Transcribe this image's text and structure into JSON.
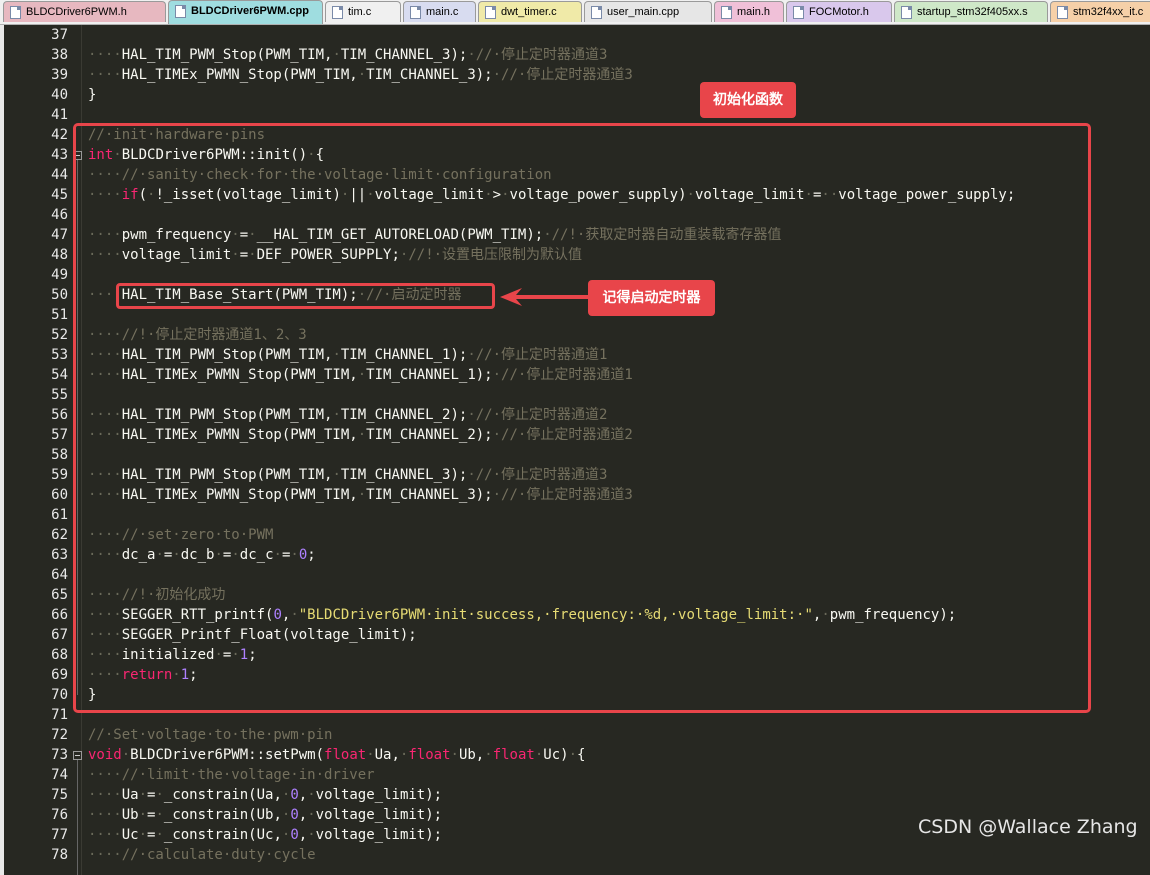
{
  "tabs": [
    {
      "label": "BLDCDriver6PWM.h",
      "color": "#e7b8c0"
    },
    {
      "label": "BLDCDriver6PWM.cpp",
      "color": "#9fdde0",
      "active": true
    },
    {
      "label": "tim.c",
      "color": "#f0f0f0"
    },
    {
      "label": "main.c",
      "color": "#d8dcf0"
    },
    {
      "label": "dwt_timer.c",
      "color": "#f0eaa8"
    },
    {
      "label": "user_main.cpp",
      "color": "#e6e6e6"
    },
    {
      "label": "main.h",
      "color": "#f0c0d8"
    },
    {
      "label": "FOCMotor.h",
      "color": "#d9c8ec"
    },
    {
      "label": "startup_stm32f405xx.s",
      "color": "#cfe8c8"
    },
    {
      "label": "stm32f4xx_it.c",
      "color": "#f6d0a8"
    }
  ],
  "lines": [
    {
      "n": "37",
      "t": []
    },
    {
      "n": "38",
      "t": [
        [
          "ws",
          "····"
        ],
        [
          "",
          "HAL_TIM_PWM_Stop(PWM_TIM,"
        ],
        [
          "ws",
          "·"
        ],
        [
          "",
          "TIM_CHANNEL_3);"
        ],
        [
          "ws",
          "·"
        ],
        [
          "cm",
          "//·停止定时器通道3"
        ]
      ]
    },
    {
      "n": "39",
      "t": [
        [
          "ws",
          "····"
        ],
        [
          "",
          "HAL_TIMEx_PWMN_Stop(PWM_TIM,"
        ],
        [
          "ws",
          "·"
        ],
        [
          "",
          "TIM_CHANNEL_3);"
        ],
        [
          "ws",
          "·"
        ],
        [
          "cm",
          "//·停止定时器通道3"
        ]
      ]
    },
    {
      "n": "40",
      "t": [
        [
          "",
          "}"
        ]
      ]
    },
    {
      "n": "41",
      "t": []
    },
    {
      "n": "42",
      "t": [
        [
          "cm",
          "//·init·hardware·pins"
        ]
      ]
    },
    {
      "n": "43",
      "t": [
        [
          "kw",
          "int"
        ],
        [
          "ws",
          "·"
        ],
        [
          "",
          "BLDCDriver6PWM::init()"
        ],
        [
          "ws",
          "·"
        ],
        [
          "",
          "{"
        ]
      ],
      "fold": true
    },
    {
      "n": "44",
      "t": [
        [
          "ws",
          "····"
        ],
        [
          "cm",
          "//·sanity·check·for·the·voltage·limit·configuration"
        ]
      ]
    },
    {
      "n": "45",
      "t": [
        [
          "ws",
          "····"
        ],
        [
          "kw",
          "if"
        ],
        [
          "",
          "("
        ],
        [
          "ws",
          "·"
        ],
        [
          "",
          "!_isset(voltage_limit)"
        ],
        [
          "ws",
          "·"
        ],
        [
          "",
          "||"
        ],
        [
          "ws",
          "·"
        ],
        [
          "",
          "voltage_limit"
        ],
        [
          "ws",
          "·"
        ],
        [
          "",
          ">"
        ],
        [
          "ws",
          "·"
        ],
        [
          "",
          "voltage_power_supply)"
        ],
        [
          "ws",
          "·"
        ],
        [
          "",
          "voltage_limit"
        ],
        [
          "ws",
          "·"
        ],
        [
          "",
          "="
        ],
        [
          "ws",
          "··"
        ],
        [
          "",
          "voltage_power_supply;"
        ]
      ]
    },
    {
      "n": "46",
      "t": []
    },
    {
      "n": "47",
      "t": [
        [
          "ws",
          "····"
        ],
        [
          "",
          "pwm_frequency"
        ],
        [
          "ws",
          "·"
        ],
        [
          "",
          "="
        ],
        [
          "ws",
          "·"
        ],
        [
          "",
          "__HAL_TIM_GET_AUTORELOAD(PWM_TIM);"
        ],
        [
          "ws",
          "·"
        ],
        [
          "cm",
          "//!·获取定时器自动重装载寄存器值"
        ]
      ]
    },
    {
      "n": "48",
      "t": [
        [
          "ws",
          "····"
        ],
        [
          "",
          "voltage_limit"
        ],
        [
          "ws",
          "·"
        ],
        [
          "",
          "="
        ],
        [
          "ws",
          "·"
        ],
        [
          "",
          "DEF_POWER_SUPPLY;"
        ],
        [
          "ws",
          "·"
        ],
        [
          "cm",
          "//!·设置电压限制为默认值"
        ]
      ]
    },
    {
      "n": "49",
      "t": []
    },
    {
      "n": "50",
      "t": [
        [
          "ws",
          "····"
        ],
        [
          "",
          "HAL_TIM_Base_Start(PWM_TIM);"
        ],
        [
          "ws",
          "·"
        ],
        [
          "cm",
          "//·启动定时器"
        ]
      ]
    },
    {
      "n": "51",
      "t": []
    },
    {
      "n": "52",
      "t": [
        [
          "ws",
          "····"
        ],
        [
          "cm",
          "//!·停止定时器通道1、2、3"
        ]
      ]
    },
    {
      "n": "53",
      "t": [
        [
          "ws",
          "····"
        ],
        [
          "",
          "HAL_TIM_PWM_Stop(PWM_TIM,"
        ],
        [
          "ws",
          "·"
        ],
        [
          "",
          "TIM_CHANNEL_1);"
        ],
        [
          "ws",
          "·"
        ],
        [
          "cm",
          "//·停止定时器通道1"
        ]
      ]
    },
    {
      "n": "54",
      "t": [
        [
          "ws",
          "····"
        ],
        [
          "",
          "HAL_TIMEx_PWMN_Stop(PWM_TIM,"
        ],
        [
          "ws",
          "·"
        ],
        [
          "",
          "TIM_CHANNEL_1);"
        ],
        [
          "ws",
          "·"
        ],
        [
          "cm",
          "//·停止定时器通道1"
        ]
      ]
    },
    {
      "n": "55",
      "t": []
    },
    {
      "n": "56",
      "t": [
        [
          "ws",
          "····"
        ],
        [
          "",
          "HAL_TIM_PWM_Stop(PWM_TIM,"
        ],
        [
          "ws",
          "·"
        ],
        [
          "",
          "TIM_CHANNEL_2);"
        ],
        [
          "ws",
          "·"
        ],
        [
          "cm",
          "//·停止定时器通道2"
        ]
      ]
    },
    {
      "n": "57",
      "t": [
        [
          "ws",
          "····"
        ],
        [
          "",
          "HAL_TIMEx_PWMN_Stop(PWM_TIM,"
        ],
        [
          "ws",
          "·"
        ],
        [
          "",
          "TIM_CHANNEL_2);"
        ],
        [
          "ws",
          "·"
        ],
        [
          "cm",
          "//·停止定时器通道2"
        ]
      ]
    },
    {
      "n": "58",
      "t": []
    },
    {
      "n": "59",
      "t": [
        [
          "ws",
          "····"
        ],
        [
          "",
          "HAL_TIM_PWM_Stop(PWM_TIM,"
        ],
        [
          "ws",
          "·"
        ],
        [
          "",
          "TIM_CHANNEL_3);"
        ],
        [
          "ws",
          "·"
        ],
        [
          "cm",
          "//·停止定时器通道3"
        ]
      ]
    },
    {
      "n": "60",
      "t": [
        [
          "ws",
          "····"
        ],
        [
          "",
          "HAL_TIMEx_PWMN_Stop(PWM_TIM,"
        ],
        [
          "ws",
          "·"
        ],
        [
          "",
          "TIM_CHANNEL_3);"
        ],
        [
          "ws",
          "·"
        ],
        [
          "cm",
          "//·停止定时器通道3"
        ]
      ]
    },
    {
      "n": "61",
      "t": []
    },
    {
      "n": "62",
      "t": [
        [
          "ws",
          "····"
        ],
        [
          "cm",
          "//·set·zero·to·PWM"
        ]
      ]
    },
    {
      "n": "63",
      "t": [
        [
          "ws",
          "····"
        ],
        [
          "",
          "dc_a"
        ],
        [
          "ws",
          "·"
        ],
        [
          "",
          "="
        ],
        [
          "ws",
          "·"
        ],
        [
          "",
          "dc_b"
        ],
        [
          "ws",
          "·"
        ],
        [
          "",
          "="
        ],
        [
          "ws",
          "·"
        ],
        [
          "",
          "dc_c"
        ],
        [
          "ws",
          "·"
        ],
        [
          "",
          "="
        ],
        [
          "ws",
          "·"
        ],
        [
          "num",
          "0"
        ],
        [
          "",
          ";"
        ]
      ]
    },
    {
      "n": "64",
      "t": []
    },
    {
      "n": "65",
      "t": [
        [
          "ws",
          "····"
        ],
        [
          "cm",
          "//!·初始化成功"
        ]
      ]
    },
    {
      "n": "66",
      "t": [
        [
          "ws",
          "····"
        ],
        [
          "",
          "SEGGER_RTT_printf("
        ],
        [
          "num",
          "0"
        ],
        [
          "",
          ","
        ],
        [
          "ws",
          "·"
        ],
        [
          "str",
          "\"BLDCDriver6PWM·init·success,·frequency:·%d,·voltage_limit:·\""
        ],
        [
          "",
          ","
        ],
        [
          "ws",
          "·"
        ],
        [
          "",
          "pwm_frequency);"
        ]
      ]
    },
    {
      "n": "67",
      "t": [
        [
          "ws",
          "····"
        ],
        [
          "",
          "SEGGER_Printf_Float(voltage_limit);"
        ]
      ]
    },
    {
      "n": "68",
      "t": [
        [
          "ws",
          "····"
        ],
        [
          "",
          "initialized"
        ],
        [
          "ws",
          "·"
        ],
        [
          "",
          "="
        ],
        [
          "ws",
          "·"
        ],
        [
          "num",
          "1"
        ],
        [
          "",
          ";"
        ]
      ]
    },
    {
      "n": "69",
      "t": [
        [
          "ws",
          "····"
        ],
        [
          "kw",
          "return"
        ],
        [
          "ws",
          "·"
        ],
        [
          "num",
          "1"
        ],
        [
          "",
          ";"
        ]
      ]
    },
    {
      "n": "70",
      "t": [
        [
          "",
          "}"
        ]
      ]
    },
    {
      "n": "71",
      "t": []
    },
    {
      "n": "72",
      "t": [
        [
          "cm",
          "//·Set·voltage·to·the·pwm·pin"
        ]
      ]
    },
    {
      "n": "73",
      "t": [
        [
          "kw",
          "void"
        ],
        [
          "ws",
          "·"
        ],
        [
          "",
          "BLDCDriver6PWM::setPwm("
        ],
        [
          "kw",
          "float"
        ],
        [
          "ws",
          "·"
        ],
        [
          "",
          "Ua,"
        ],
        [
          "ws",
          "·"
        ],
        [
          "kw",
          "float"
        ],
        [
          "ws",
          "·"
        ],
        [
          "",
          "Ub,"
        ],
        [
          "ws",
          "·"
        ],
        [
          "kw",
          "float"
        ],
        [
          "ws",
          "·"
        ],
        [
          "",
          "Uc)"
        ],
        [
          "ws",
          "·"
        ],
        [
          "",
          "{"
        ]
      ],
      "fold": true
    },
    {
      "n": "74",
      "t": [
        [
          "ws",
          "····"
        ],
        [
          "cm",
          "//·limit·the·voltage·in·driver"
        ]
      ]
    },
    {
      "n": "75",
      "t": [
        [
          "ws",
          "····"
        ],
        [
          "",
          "Ua"
        ],
        [
          "ws",
          "·"
        ],
        [
          "",
          "="
        ],
        [
          "ws",
          "·"
        ],
        [
          "",
          "_constrain(Ua,"
        ],
        [
          "ws",
          "·"
        ],
        [
          "num",
          "0"
        ],
        [
          "",
          ","
        ],
        [
          "ws",
          "·"
        ],
        [
          "",
          "voltage_limit);"
        ]
      ]
    },
    {
      "n": "76",
      "t": [
        [
          "ws",
          "····"
        ],
        [
          "",
          "Ub"
        ],
        [
          "ws",
          "·"
        ],
        [
          "",
          "="
        ],
        [
          "ws",
          "·"
        ],
        [
          "",
          "_constrain(Ub,"
        ],
        [
          "ws",
          "·"
        ],
        [
          "num",
          "0"
        ],
        [
          "",
          ","
        ],
        [
          "ws",
          "·"
        ],
        [
          "",
          "voltage_limit);"
        ]
      ]
    },
    {
      "n": "77",
      "t": [
        [
          "ws",
          "····"
        ],
        [
          "",
          "Uc"
        ],
        [
          "ws",
          "·"
        ],
        [
          "",
          "="
        ],
        [
          "ws",
          "·"
        ],
        [
          "",
          "_constrain(Uc,"
        ],
        [
          "ws",
          "·"
        ],
        [
          "num",
          "0"
        ],
        [
          "",
          ","
        ],
        [
          "ws",
          "·"
        ],
        [
          "",
          "voltage_limit);"
        ]
      ]
    },
    {
      "n": "78",
      "t": [
        [
          "ws",
          "····"
        ],
        [
          "cm",
          "//·calculate·duty·cycle"
        ]
      ]
    }
  ],
  "annotations": {
    "init_label": "初始化函数",
    "timer_label": "记得启动定时器",
    "annotation_color": "#e8454a"
  },
  "watermark": "CSDN @Wallace Zhang"
}
